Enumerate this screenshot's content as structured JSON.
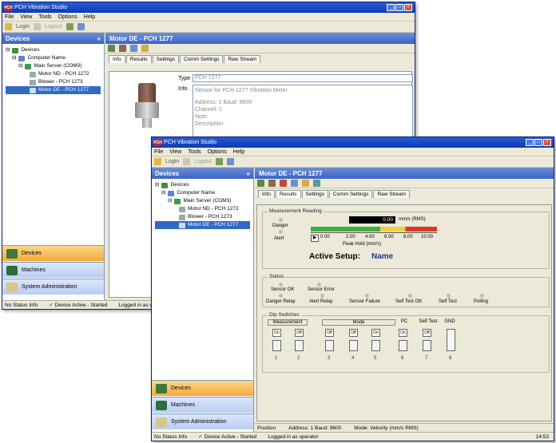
{
  "app": {
    "title": "PCH Vibration Studio",
    "icon_text": "PCH",
    "menu": [
      "File",
      "View",
      "Tools",
      "Options",
      "Help"
    ],
    "toolbar": [
      "Login",
      "Logout"
    ]
  },
  "back_window": {
    "devices_header": "Devices",
    "tree": [
      "Devices",
      "Computer Name",
      "Main Server (COM3)",
      "Motor ND - PCH 1272",
      "Blower - PCH 1273",
      "Motor DE - PCH 1277"
    ],
    "panel_title": "Motor DE - PCH 1277",
    "tabs": [
      "Info",
      "Results",
      "Settings",
      "Comm Settings",
      "Raw Stream"
    ],
    "type_label": "Type",
    "type_value": "PCH 1277",
    "info_label": "Info",
    "info_lines": [
      "Sensor for PCH 1277 Vibration Meter",
      "Address: 1 Baud: 9600",
      "Channel: 1",
      "Note:",
      "Description:"
    ],
    "nav": [
      "Devices",
      "Machines",
      "System Administration"
    ],
    "status": [
      "No Status Info",
      "Device Active - Started",
      "Logged in as operator"
    ]
  },
  "front_window": {
    "devices_header": "Devices",
    "tree": [
      "Devices",
      "Computer Name",
      "Main Server (COM3)",
      "Motor ND - PCH 1272",
      "Blower - PCH 1273",
      "Motor DE - PCH 1277"
    ],
    "panel_title": "Motor DE - PCH 1277",
    "tabs": [
      "Info",
      "Results",
      "Settings",
      "Comm Settings",
      "Raw Stream"
    ],
    "measurement_group": "Measurement Reading",
    "legend_labels": [
      "Danger",
      "Alert"
    ],
    "reading_value": "0.00",
    "reading_unit": "mm/s (RMS)",
    "scale_ticks": [
      "0.00",
      "2.00",
      "4.00",
      "6.00",
      "8.00",
      "10.00"
    ],
    "scale_note": "Peak Hold (mm/s)",
    "active_setup_label": "Active Setup:",
    "active_setup_name": "Name",
    "status_group": "Status",
    "status_row1": [
      "Sensor OK",
      "Sensor Error"
    ],
    "status_row2": [
      "Danger Relay",
      "Alert Relay",
      "Sensor Failure",
      "Self Test OK",
      "Self Test",
      "Polling"
    ],
    "dip_group": "Dip Switches",
    "dip_headers": [
      "Measurement",
      "Mode",
      "PC",
      "Self Test",
      "GND"
    ],
    "switch_values": [
      "On",
      "Off",
      "Off",
      "Off",
      "On",
      "On",
      "Off",
      "Off"
    ],
    "switch_numbers": [
      "1",
      "2",
      "3",
      "4",
      "5",
      "6",
      "7",
      "8"
    ],
    "bottom_status": [
      "Position",
      "Address: 1 Baud: 9600",
      "Mode: Velocity (mm/s RMS)"
    ],
    "nav": [
      "Devices",
      "Machines",
      "System Administration"
    ],
    "status": [
      "No Status Info",
      "Device Active - Started",
      "Logged in as operator"
    ],
    "clock": "14:53"
  },
  "colors": {
    "title_blue": "#0a3cb0",
    "header_blue": "#3a63c4",
    "selection": "#316ac5",
    "active_nav": "#f5a93a",
    "setup_name": "#1d3a8a"
  }
}
